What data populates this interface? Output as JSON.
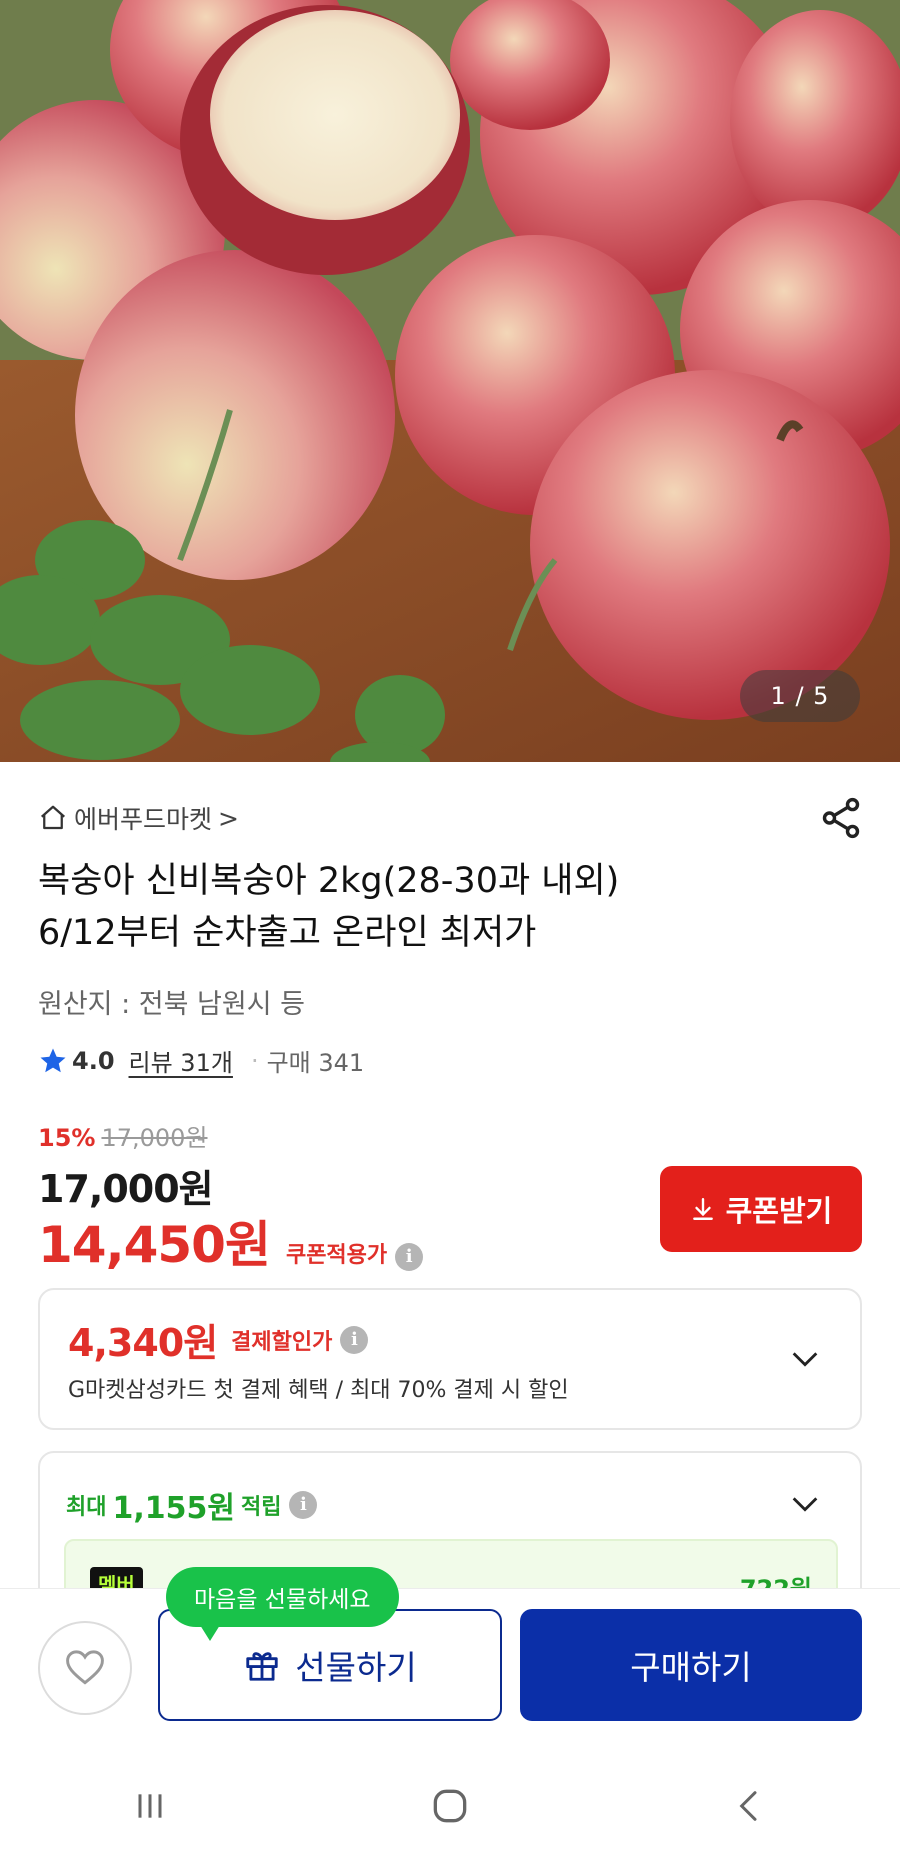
{
  "gallery": {
    "counter": "1 / 5"
  },
  "seller": {
    "name": "에버푸드마켓",
    "arrow": ">"
  },
  "product": {
    "title_line1": "복숭아 신비복숭아 2kg(28-30과 내외)",
    "title_line2": "6/12부터 순차출고 온라인 최저가",
    "origin": "원산지 : 전북 남원시 등"
  },
  "rating": {
    "score": "4.0",
    "review": "리뷰 31개",
    "separator": "·",
    "purchase": "구매 341"
  },
  "price": {
    "discount_pct": "15%",
    "original": "17,000원",
    "sale": "17,000원",
    "coupon_price": "14,450원",
    "coupon_label": "쿠폰적용가",
    "coupon_button": "쿠폰받기"
  },
  "card_discount": {
    "amount": "4,340원",
    "label": "결제할인가",
    "description": "G마켓삼성카드 첫 결제 혜택 / 최대 70% 결제 시 할인"
  },
  "points": {
    "prefix": "최대",
    "amount": "1,155원",
    "suffix": "적립",
    "badge": "멤버",
    "member_points": "722원"
  },
  "bottom_bar": {
    "tooltip": "마음을 선물하세요",
    "gift_label": "선물하기",
    "buy_label": "구매하기"
  },
  "icons": {
    "home": "home-icon",
    "share": "share-icon",
    "star": "star-icon",
    "info": "info-icon",
    "download": "download-icon",
    "chevron": "chevron-down-icon",
    "heart": "heart-icon",
    "gift": "gift-icon"
  },
  "colors": {
    "accent_red": "#e3201b",
    "primary_blue": "#0b2fa8",
    "point_green": "#1fa12a",
    "tooltip_green": "#19c24a"
  }
}
